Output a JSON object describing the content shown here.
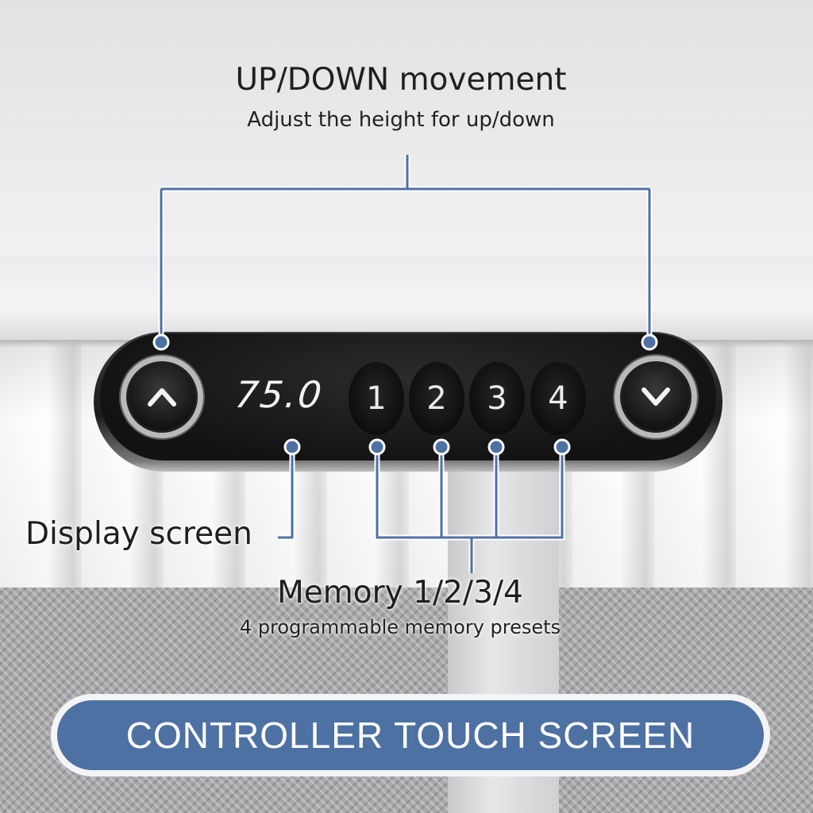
{
  "annotations": {
    "updown_title": "UP/DOWN movement",
    "updown_subtitle": "Adjust the height for up/down",
    "display_title": "Display screen",
    "memory_title": "Memory 1/2/3/4",
    "memory_subtitle": "4 programmable memory presets"
  },
  "controller": {
    "up_button_icon": "chevron-up-icon",
    "down_button_icon": "chevron-down-icon",
    "display_value": "75.0",
    "memory_buttons": [
      "1",
      "2",
      "3",
      "4"
    ]
  },
  "banner": {
    "label": "CONTROLLER TOUCH SCREEN"
  },
  "colors": {
    "annotation_line": "#4e71a4",
    "banner_fill": "#4e71a4",
    "controller_body": "#1a1a1b"
  }
}
